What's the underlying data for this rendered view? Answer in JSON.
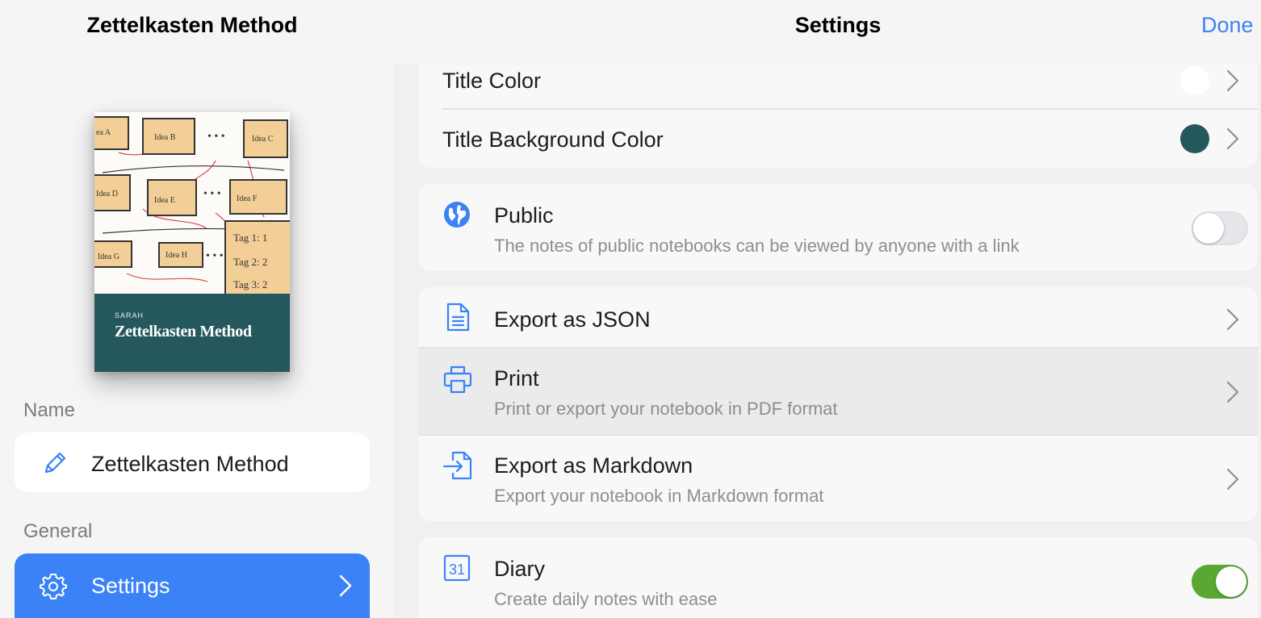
{
  "left": {
    "notebook_title": "Zettelkasten Method",
    "cover": {
      "author": "SARAH",
      "title": "Zettelkasten Method"
    },
    "name_section_label": "Name",
    "name_value": "Zettelkasten Method",
    "general_section_label": "General",
    "settings_label": "Settings"
  },
  "header": {
    "title": "Settings",
    "done_label": "Done"
  },
  "appearance": {
    "title_color_label": "Title Color",
    "title_color": "#ffffff",
    "title_bg_color_label": "Title Background Color",
    "title_bg_color": "#24585c"
  },
  "public": {
    "label": "Public",
    "description": "The notes of public notebooks can be viewed by anyone with a link",
    "enabled": false
  },
  "export": {
    "json_label": "Export as JSON",
    "print_label": "Print",
    "print_description": "Print or export your notebook in PDF format",
    "markdown_label": "Export as Markdown",
    "markdown_description": "Export your notebook in Markdown format"
  },
  "diary": {
    "label": "Diary",
    "description": "Create daily notes with ease",
    "icon_day": "31",
    "enabled": true
  },
  "colors": {
    "accent": "#3b82f6",
    "toggle_on": "#5aa732",
    "toggle_off": "#e5e5ea"
  }
}
